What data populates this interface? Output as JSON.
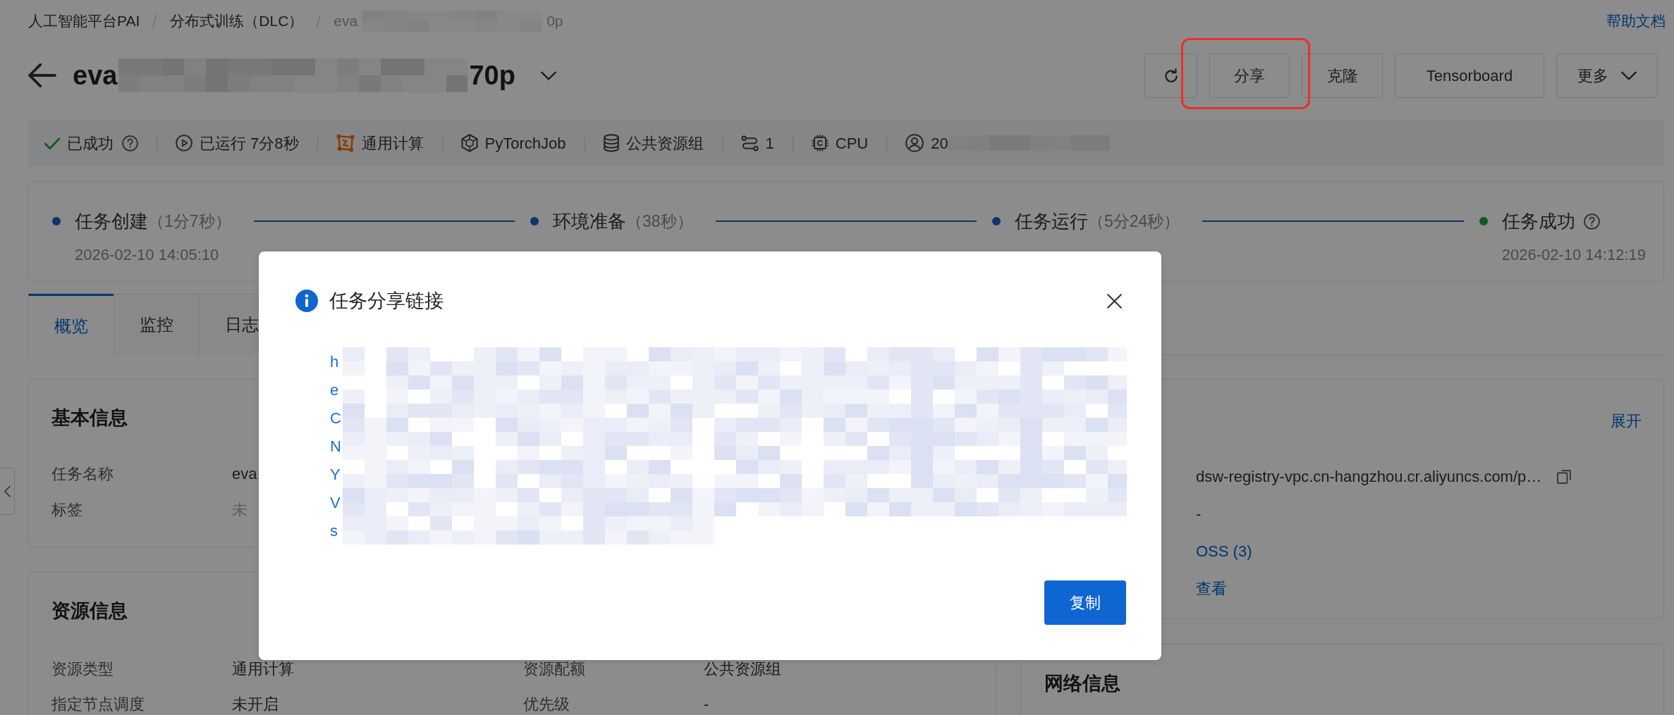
{
  "breadcrumb": {
    "items": [
      {
        "label": "人工智能平台PAI"
      },
      {
        "label": "分布式训练（DLC）"
      }
    ],
    "current": {
      "prefix": "eva",
      "suffix": "0p"
    },
    "help_link": "帮助文档"
  },
  "header": {
    "title": {
      "prefix": "eva",
      "suffix": "70p"
    },
    "actions": [
      {
        "kind": "icon",
        "highlighted": false
      },
      {
        "kind": "text",
        "label": "分享",
        "highlighted": true
      },
      {
        "kind": "text",
        "label": "克隆",
        "highlighted": false
      },
      {
        "kind": "text",
        "label": "Tensorboard",
        "highlighted": false
      },
      {
        "kind": "dropdown",
        "label": "更多",
        "highlighted": false
      }
    ]
  },
  "status_bar": [
    {
      "kind": "status",
      "text": "已成功",
      "help": true
    },
    {
      "kind": "duration",
      "text": "已运行 7分8秒",
      "help": false
    },
    {
      "kind": "compute",
      "text": "通用计算",
      "help": false
    },
    {
      "kind": "framework",
      "text": "PyTorchJob",
      "help": false
    },
    {
      "kind": "resource",
      "text": "公共资源组",
      "help": false
    },
    {
      "kind": "nodes",
      "text": "1",
      "help": false
    },
    {
      "kind": "device",
      "text": "CPU",
      "help": false
    },
    {
      "kind": "owner",
      "text": "20",
      "help": false
    }
  ],
  "timeline": [
    {
      "title": "任务创建",
      "duration": "（1分7秒）",
      "time": "2026-02-10 14:05:10",
      "success": false,
      "help": false
    },
    {
      "title": "环境准备",
      "duration": "（38秒）",
      "success": false,
      "help": false
    },
    {
      "title": "任务运行",
      "duration": "（5分24秒）",
      "success": false,
      "help": false
    },
    {
      "title": "任务成功",
      "time": "2026-02-10 14:12:19",
      "success": true,
      "help": true
    }
  ],
  "tabs": [
    {
      "label": "概览",
      "selected": true
    },
    {
      "label": "监控",
      "selected": false
    },
    {
      "label": "日志",
      "selected": false
    }
  ],
  "basic_info": {
    "title": "基本信息",
    "rows": [
      {
        "label": "任务名称",
        "value": "eva",
        "empty": false
      },
      {
        "label": "标签",
        "value": "未",
        "empty": true
      }
    ]
  },
  "resource_info": {
    "title": "资源信息",
    "rows": [
      {
        "label": "资源类型",
        "value": "通用计算"
      },
      {
        "label": "资源配额",
        "value": "公共资源组"
      },
      {
        "label": "指定节点调度",
        "value": "未开启"
      },
      {
        "label": "优先级",
        "value": "-"
      }
    ]
  },
  "right_card": {
    "action": "展开",
    "rows": [
      {
        "kind": "copyable",
        "value": "dsw-registry-vpc.cn-hangzhou.cr.aliyuncs.com/p…"
      },
      {
        "kind": "text",
        "value": "-"
      },
      {
        "kind": "link",
        "value": "OSS (3)"
      },
      {
        "kind": "link",
        "value": "查看"
      }
    ]
  },
  "network_info": {
    "title": "网络信息"
  },
  "dialog": {
    "title": "任务分享链接",
    "link_lines": [
      "h",
      "e",
      "C",
      "N",
      "Y",
      "V",
      "s"
    ],
    "copy_button": "复制"
  }
}
